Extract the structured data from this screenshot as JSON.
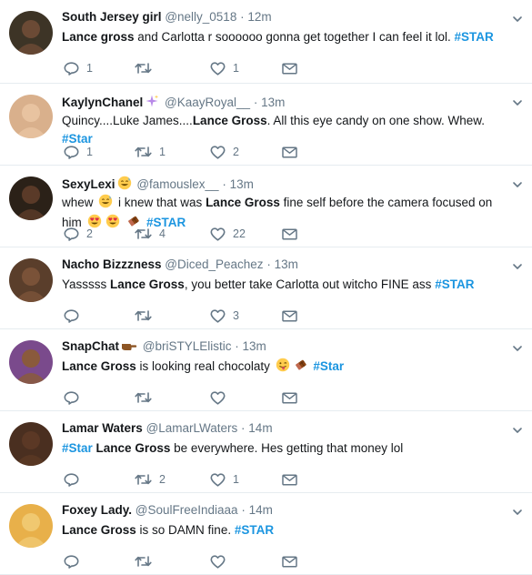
{
  "tweets": [
    {
      "name": "South Jersey girl",
      "handle": "@nelly_0518",
      "time": "12m",
      "segments": [
        {
          "t": "Lance gross",
          "s": "b"
        },
        {
          "t": " and Carlotta r soooooo gonna get together I can feel it lol. ",
          "s": ""
        },
        {
          "t": "#STAR",
          "s": "tag"
        }
      ],
      "reply_count": "1",
      "retweet_count": "",
      "like_count": "1",
      "avatar_color": "#3d3426"
    },
    {
      "name": "KaylynChanel",
      "handle": "@KaayRoyal__",
      "time": "13m",
      "name_emoji": "sparkles-emoji",
      "segments": [
        {
          "t": "Quincy....Luke James....",
          "s": ""
        },
        {
          "t": "Lance Gross",
          "s": "b"
        },
        {
          "t": ". All this eye candy on one show. Whew. ",
          "s": ""
        },
        {
          "t": "#Star",
          "s": "tag"
        }
      ],
      "reply_count": "1",
      "retweet_count": "1",
      "like_count": "2",
      "avatar_color": "#d9b08c"
    },
    {
      "name": "SexyLexi",
      "handle": "@famouslex__",
      "time": "13m",
      "name_emoji": "grin-sweat-emoji",
      "segments": [
        {
          "t": "whew ",
          "s": ""
        },
        {
          "t": "",
          "s": "emoji:grin-sweat-emoji"
        },
        {
          "t": " i knew that was ",
          "s": ""
        },
        {
          "t": "Lance Gross",
          "s": "b"
        },
        {
          "t": " fine self before the camera focused on him ",
          "s": ""
        },
        {
          "t": "",
          "s": "emoji:heart-eyes-emoji"
        },
        {
          "t": "",
          "s": "emoji:heart-eyes-emoji"
        },
        {
          "t": " ",
          "s": ""
        },
        {
          "t": "",
          "s": "emoji:chocolate-emoji"
        },
        {
          "t": " ",
          "s": ""
        },
        {
          "t": "#STAR",
          "s": "tag"
        }
      ],
      "reply_count": "2",
      "retweet_count": "4",
      "like_count": "22",
      "avatar_color": "#2b2118"
    },
    {
      "name": "Nacho Bizzzness",
      "handle": "@Diced_Peachez",
      "time": "13m",
      "segments": [
        {
          "t": "Yasssss ",
          "s": ""
        },
        {
          "t": "Lance Gross",
          "s": "b"
        },
        {
          "t": ", you better take Carlotta out witcho FINE ass ",
          "s": ""
        },
        {
          "t": "#STAR",
          "s": "tag"
        }
      ],
      "reply_count": "",
      "retweet_count": "",
      "like_count": "3",
      "avatar_color": "#5a3e2b"
    },
    {
      "name": "SnapChat",
      "handle": "@briSTYLElistic",
      "time": "13m",
      "name_emoji": "pointing-hand-emoji",
      "segments": [
        {
          "t": "Lance Gross",
          "s": "b"
        },
        {
          "t": " is looking real chocolaty ",
          "s": ""
        },
        {
          "t": "",
          "s": "emoji:tongue-wink-emoji"
        },
        {
          "t": "",
          "s": "emoji:chocolate-emoji"
        },
        {
          "t": " ",
          "s": ""
        },
        {
          "t": "#Star",
          "s": "tag"
        }
      ],
      "reply_count": "",
      "retweet_count": "",
      "like_count": "",
      "avatar_color": "#7a4a8c"
    },
    {
      "name": "Lamar Waters",
      "handle": "@LamarLWaters",
      "time": "14m",
      "segments": [
        {
          "t": "#Star",
          "s": "tag"
        },
        {
          "t": " ",
          "s": ""
        },
        {
          "t": "Lance Gross",
          "s": "b"
        },
        {
          "t": " be everywhere. Hes getting that money lol",
          "s": ""
        }
      ],
      "reply_count": "",
      "retweet_count": "2",
      "like_count": "1",
      "avatar_color": "#4a2f20"
    },
    {
      "name": "Foxey Lady.",
      "handle": "@SoulFreeIndiaaa",
      "time": "14m",
      "segments": [
        {
          "t": "Lance Gross",
          "s": "b"
        },
        {
          "t": " is so DAMN fine. ",
          "s": ""
        },
        {
          "t": "#STAR",
          "s": "tag"
        }
      ],
      "reply_count": "",
      "retweet_count": "",
      "like_count": "",
      "avatar_color": "#e8b04a"
    }
  ],
  "colors": {
    "hashtag": "#1b95e0",
    "meta": "#657786",
    "icon": "#657786",
    "divider": "#e6ecf0"
  }
}
